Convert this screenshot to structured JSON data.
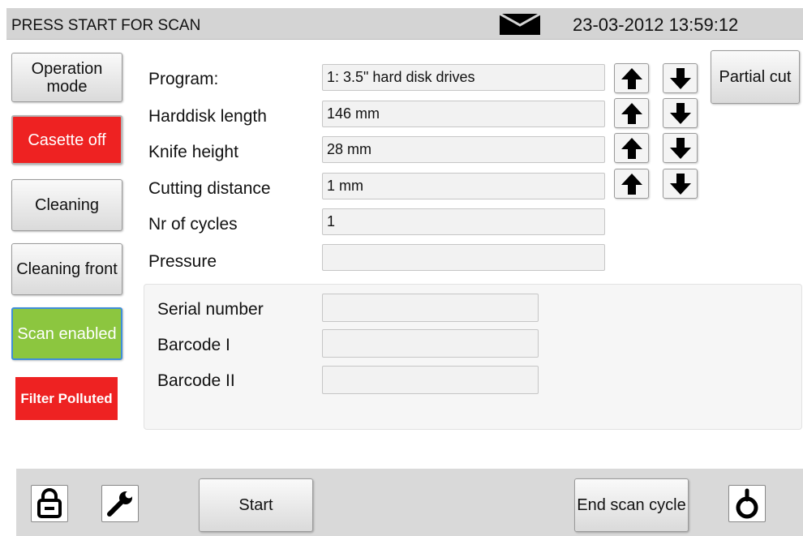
{
  "status": {
    "message": "PRESS START FOR SCAN",
    "datetime": "23-03-2012 13:59:12",
    "mail_icon": "envelope-icon"
  },
  "sidebar": {
    "operation_mode": "Operation mode",
    "casette": "Casette off",
    "cleaning": "Cleaning",
    "cleaning_front": "Cleaning front",
    "scan": "Scan enabled",
    "filter": "Filter Polluted"
  },
  "settings": {
    "program": {
      "label": "Program:",
      "value": "1: 3.5\" hard disk drives"
    },
    "harddisk_length": {
      "label": "Harddisk length",
      "value": "146 mm"
    },
    "knife_height": {
      "label": "Knife height",
      "value": "28 mm"
    },
    "cutting_distance": {
      "label": "Cutting distance",
      "value": "1 mm"
    },
    "nr_of_cycles": {
      "label": "Nr of cycles",
      "value": "1"
    },
    "pressure": {
      "label": "Pressure",
      "value": ""
    }
  },
  "partial_cut": "Partial cut",
  "scan": {
    "serial_number": {
      "label": "Serial number",
      "value": ""
    },
    "barcode_1": {
      "label": "Barcode I",
      "value": ""
    },
    "barcode_2": {
      "label": "Barcode II",
      "value": ""
    }
  },
  "footer": {
    "start": "Start",
    "end_scan": "End scan cycle",
    "lock_icon": "lock-icon",
    "wrench_icon": "wrench-icon",
    "power_icon": "power-icon"
  },
  "colors": {
    "alert_red": "#ee2222",
    "enabled_green": "#8cc63f",
    "enabled_border": "#3f8ed8",
    "topbar": "#d4d4d4"
  }
}
